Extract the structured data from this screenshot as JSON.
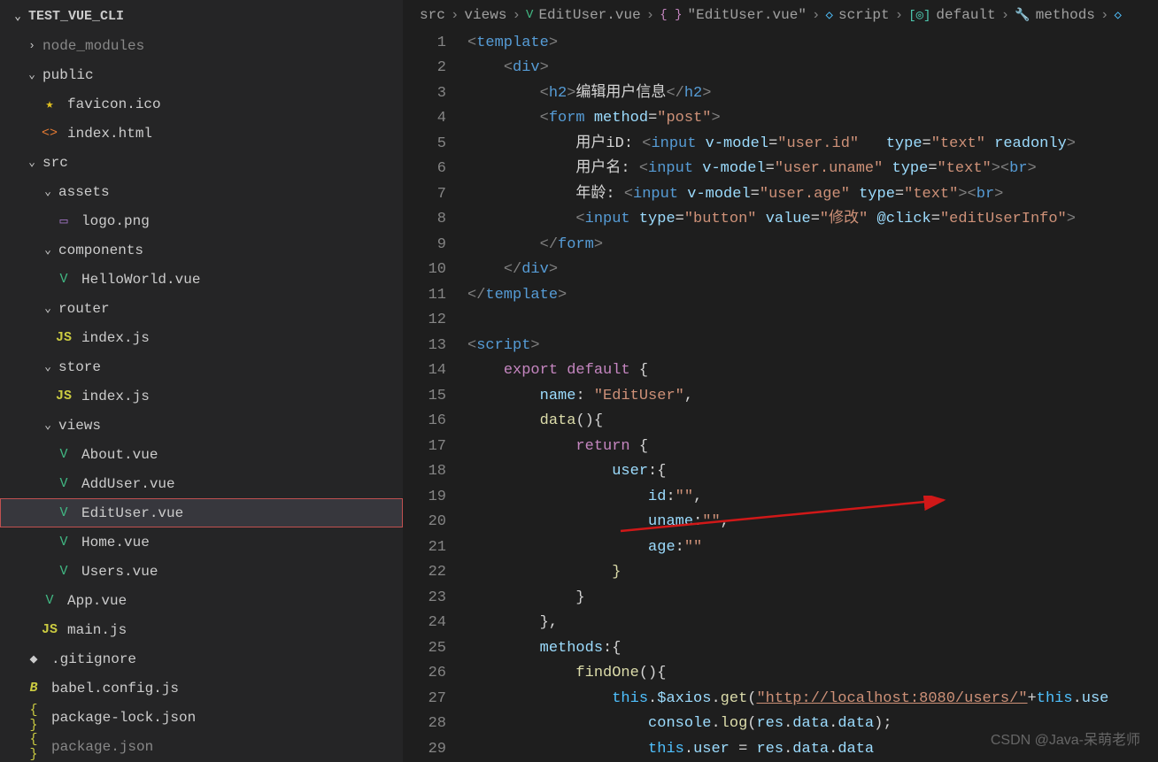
{
  "explorer": {
    "title": "TEST_VUE_CLI",
    "tree": [
      {
        "type": "folder",
        "level": 1,
        "expanded": false,
        "label": "node_modules",
        "dimmed": true
      },
      {
        "type": "folder",
        "level": 1,
        "expanded": true,
        "label": "public"
      },
      {
        "type": "file",
        "level": 2,
        "icon": "star",
        "label": "favicon.ico"
      },
      {
        "type": "file",
        "level": 2,
        "icon": "html",
        "label": "index.html"
      },
      {
        "type": "folder",
        "level": 1,
        "expanded": true,
        "label": "src"
      },
      {
        "type": "folder",
        "level": 2,
        "expanded": true,
        "label": "assets"
      },
      {
        "type": "file",
        "level": 3,
        "icon": "img",
        "label": "logo.png"
      },
      {
        "type": "folder",
        "level": 2,
        "expanded": true,
        "label": "components"
      },
      {
        "type": "file",
        "level": 3,
        "icon": "vue",
        "label": "HelloWorld.vue"
      },
      {
        "type": "folder",
        "level": 2,
        "expanded": true,
        "label": "router"
      },
      {
        "type": "file",
        "level": 3,
        "icon": "js",
        "label": "index.js"
      },
      {
        "type": "folder",
        "level": 2,
        "expanded": true,
        "label": "store"
      },
      {
        "type": "file",
        "level": 3,
        "icon": "js",
        "label": "index.js"
      },
      {
        "type": "folder",
        "level": 2,
        "expanded": true,
        "label": "views"
      },
      {
        "type": "file",
        "level": 3,
        "icon": "vue",
        "label": "About.vue"
      },
      {
        "type": "file",
        "level": 3,
        "icon": "vue",
        "label": "AddUser.vue"
      },
      {
        "type": "file",
        "level": 3,
        "icon": "vue",
        "label": "EditUser.vue",
        "selected": true
      },
      {
        "type": "file",
        "level": 3,
        "icon": "vue",
        "label": "Home.vue"
      },
      {
        "type": "file",
        "level": 3,
        "icon": "vue",
        "label": "Users.vue"
      },
      {
        "type": "file",
        "level": 2,
        "icon": "vue",
        "label": "App.vue"
      },
      {
        "type": "file",
        "level": 2,
        "icon": "js",
        "label": "main.js"
      },
      {
        "type": "file",
        "level": 1,
        "icon": "none",
        "label": ".gitignore"
      },
      {
        "type": "file",
        "level": 1,
        "icon": "babel",
        "label": "babel.config.js"
      },
      {
        "type": "file",
        "level": 1,
        "icon": "json",
        "label": "package-lock.json"
      },
      {
        "type": "file",
        "level": 1,
        "icon": "json",
        "label": "package.json",
        "dimmed": true
      }
    ]
  },
  "breadcrumbs": [
    {
      "label": "src"
    },
    {
      "label": "views"
    },
    {
      "icon": "vue",
      "label": "EditUser.vue"
    },
    {
      "icon": "brace",
      "label": "\"EditUser.vue\""
    },
    {
      "icon": "cube",
      "label": "script"
    },
    {
      "icon": "inter",
      "label": "default"
    },
    {
      "icon": "wrench",
      "label": "methods"
    },
    {
      "icon": "cube2",
      "label": ""
    }
  ],
  "code": {
    "start_line": 1,
    "lines": [
      [
        [
          "b",
          "<"
        ],
        [
          "t",
          "template"
        ],
        [
          "b",
          ">"
        ]
      ],
      [
        [
          "p",
          "    "
        ],
        [
          "b",
          "<"
        ],
        [
          "t",
          "div"
        ],
        [
          "b",
          ">"
        ]
      ],
      [
        [
          "p",
          "        "
        ],
        [
          "b",
          "<"
        ],
        [
          "t",
          "h2"
        ],
        [
          "b",
          ">"
        ],
        [
          "p",
          "编辑用户信息"
        ],
        [
          "b",
          "</"
        ],
        [
          "t",
          "h2"
        ],
        [
          "b",
          ">"
        ]
      ],
      [
        [
          "p",
          "        "
        ],
        [
          "b",
          "<"
        ],
        [
          "t",
          "form"
        ],
        [
          "p",
          " "
        ],
        [
          "a",
          "method"
        ],
        [
          "p",
          "="
        ],
        [
          "s",
          "\"post\""
        ],
        [
          "b",
          ">"
        ]
      ],
      [
        [
          "p",
          "            用户iD: "
        ],
        [
          "b",
          "<"
        ],
        [
          "t",
          "input"
        ],
        [
          "p",
          " "
        ],
        [
          "a",
          "v-model"
        ],
        [
          "p",
          "="
        ],
        [
          "s",
          "\"user.id\""
        ],
        [
          "p",
          "   "
        ],
        [
          "a",
          "type"
        ],
        [
          "p",
          "="
        ],
        [
          "s",
          "\"text\""
        ],
        [
          "p",
          " "
        ],
        [
          "a",
          "readonly"
        ],
        [
          "b",
          ">"
        ]
      ],
      [
        [
          "p",
          "            用户名: "
        ],
        [
          "b",
          "<"
        ],
        [
          "t",
          "input"
        ],
        [
          "p",
          " "
        ],
        [
          "a",
          "v-model"
        ],
        [
          "p",
          "="
        ],
        [
          "s",
          "\"user.uname\""
        ],
        [
          "p",
          " "
        ],
        [
          "a",
          "type"
        ],
        [
          "p",
          "="
        ],
        [
          "s",
          "\"text\""
        ],
        [
          "b",
          "><"
        ],
        [
          "t",
          "br"
        ],
        [
          "b",
          ">"
        ]
      ],
      [
        [
          "p",
          "            年龄: "
        ],
        [
          "b",
          "<"
        ],
        [
          "t",
          "input"
        ],
        [
          "p",
          " "
        ],
        [
          "a",
          "v-model"
        ],
        [
          "p",
          "="
        ],
        [
          "s",
          "\"user.age\""
        ],
        [
          "p",
          " "
        ],
        [
          "a",
          "type"
        ],
        [
          "p",
          "="
        ],
        [
          "s",
          "\"text\""
        ],
        [
          "b",
          "><"
        ],
        [
          "t",
          "br"
        ],
        [
          "b",
          ">"
        ]
      ],
      [
        [
          "p",
          "            "
        ],
        [
          "b",
          "<"
        ],
        [
          "t",
          "input"
        ],
        [
          "p",
          " "
        ],
        [
          "a",
          "type"
        ],
        [
          "p",
          "="
        ],
        [
          "s",
          "\"button\""
        ],
        [
          "p",
          " "
        ],
        [
          "a",
          "value"
        ],
        [
          "p",
          "="
        ],
        [
          "s",
          "\"修改\""
        ],
        [
          "p",
          " "
        ],
        [
          "a",
          "@click"
        ],
        [
          "p",
          "="
        ],
        [
          "s",
          "\"editUserInfo\""
        ],
        [
          "b",
          ">"
        ]
      ],
      [
        [
          "p",
          "        "
        ],
        [
          "b",
          "</"
        ],
        [
          "t",
          "form"
        ],
        [
          "b",
          ">"
        ]
      ],
      [
        [
          "p",
          "    "
        ],
        [
          "b",
          "</"
        ],
        [
          "t",
          "div"
        ],
        [
          "b",
          ">"
        ]
      ],
      [
        [
          "b",
          "</"
        ],
        [
          "t",
          "template"
        ],
        [
          "b",
          ">"
        ]
      ],
      [],
      [
        [
          "b",
          "<"
        ],
        [
          "t",
          "script"
        ],
        [
          "b",
          ">"
        ]
      ],
      [
        [
          "p",
          "    "
        ],
        [
          "k",
          "export"
        ],
        [
          "p",
          " "
        ],
        [
          "k",
          "default"
        ],
        [
          "p",
          " {"
        ]
      ],
      [
        [
          "p",
          "        "
        ],
        [
          "v",
          "name"
        ],
        [
          "p",
          ": "
        ],
        [
          "s",
          "\"EditUser\""
        ],
        [
          "p",
          ","
        ]
      ],
      [
        [
          "p",
          "        "
        ],
        [
          "f",
          "data"
        ],
        [
          "p",
          "(){"
        ]
      ],
      [
        [
          "p",
          "            "
        ],
        [
          "k",
          "return"
        ],
        [
          "p",
          " {"
        ]
      ],
      [
        [
          "p",
          "                "
        ],
        [
          "v",
          "user"
        ],
        [
          "p",
          ":{"
        ]
      ],
      [
        [
          "p",
          "                    "
        ],
        [
          "v",
          "id"
        ],
        [
          "p",
          ":"
        ],
        [
          "s",
          "\"\""
        ],
        [
          "p",
          ","
        ]
      ],
      [
        [
          "p",
          "                    "
        ],
        [
          "v",
          "uname"
        ],
        [
          "p",
          ":"
        ],
        [
          "s",
          "\"\""
        ],
        [
          "p",
          ","
        ]
      ],
      [
        [
          "p",
          "                    "
        ],
        [
          "v",
          "age"
        ],
        [
          "p",
          ":"
        ],
        [
          "s",
          "\"\""
        ]
      ],
      [
        [
          "p",
          "                "
        ],
        [
          "f",
          "}"
        ]
      ],
      [
        [
          "p",
          "            }"
        ]
      ],
      [
        [
          "p",
          "        },"
        ]
      ],
      [
        [
          "p",
          "        "
        ],
        [
          "v",
          "methods"
        ],
        [
          "p",
          ":{"
        ]
      ],
      [
        [
          "p",
          "            "
        ],
        [
          "f",
          "findOne"
        ],
        [
          "p",
          "(){"
        ]
      ],
      [
        [
          "p",
          "                "
        ],
        [
          "n",
          "this"
        ],
        [
          "p",
          "."
        ],
        [
          "v",
          "$axios"
        ],
        [
          "p",
          "."
        ],
        [
          "f",
          "get"
        ],
        [
          "p",
          "("
        ],
        [
          "u",
          "\"http://localhost:8080/users/\""
        ],
        [
          "p",
          "+"
        ],
        [
          "n",
          "this"
        ],
        [
          "p",
          "."
        ],
        [
          "v",
          "use"
        ]
      ],
      [
        [
          "p",
          "                    "
        ],
        [
          "v",
          "console"
        ],
        [
          "p",
          "."
        ],
        [
          "f",
          "log"
        ],
        [
          "p",
          "("
        ],
        [
          "v",
          "res"
        ],
        [
          "p",
          "."
        ],
        [
          "v",
          "data"
        ],
        [
          "p",
          "."
        ],
        [
          "v",
          "data"
        ],
        [
          "p",
          ");"
        ]
      ],
      [
        [
          "p",
          "                    "
        ],
        [
          "n",
          "this"
        ],
        [
          "p",
          "."
        ],
        [
          "v",
          "user"
        ],
        [
          "p",
          " = "
        ],
        [
          "v",
          "res"
        ],
        [
          "p",
          "."
        ],
        [
          "v",
          "data"
        ],
        [
          "p",
          "."
        ],
        [
          "v",
          "data"
        ]
      ]
    ]
  },
  "watermark": "CSDN @Java-呆萌老师"
}
